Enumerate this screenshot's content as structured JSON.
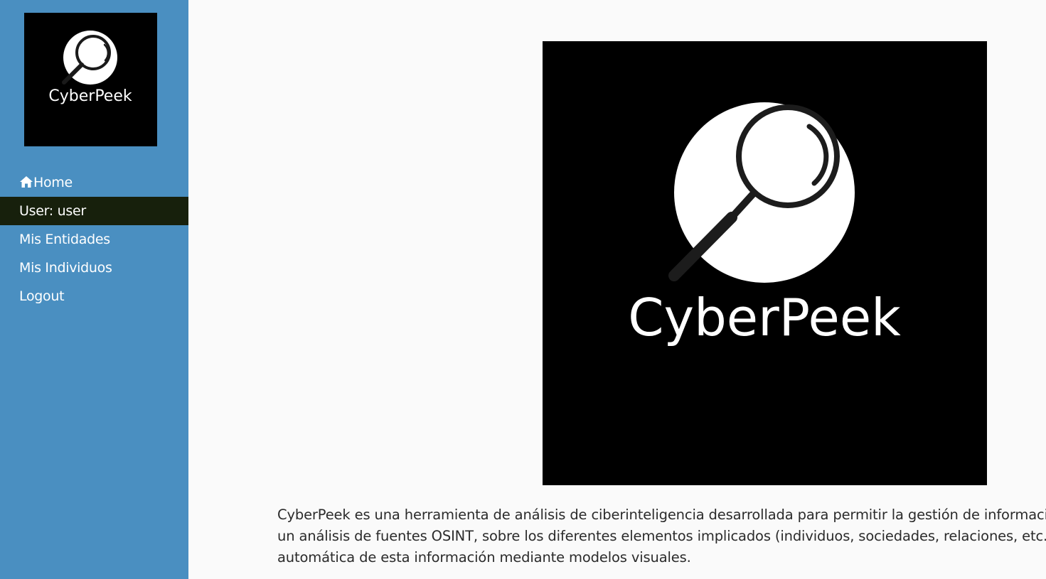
{
  "sidebar": {
    "logo": {
      "icon": "magnifier-icon",
      "text": "CyberPeek"
    },
    "nav": [
      {
        "icon": "home-icon",
        "label": "Home"
      },
      {
        "label": "User: user"
      },
      {
        "label": "Mis Entidades"
      },
      {
        "label": "Mis Individuos"
      },
      {
        "label": "Logout"
      }
    ]
  },
  "main": {
    "hero": {
      "icon": "magnifier-icon",
      "text": "CyberPeek"
    },
    "description": {
      "lines": [
        "CyberPeek es una herramienta de análisis de ciberinteligencia desarrollada para permitir la gestión de información",
        "un análisis de fuentes OSINT, sobre los diferentes elementos implicados (individuos, sociedades, relaciones, etc.)",
        "automática de esta información mediante modelos visuales."
      ]
    }
  },
  "colors": {
    "sidebar_bg": "#4a8fc1",
    "active_item_bg": "#17200c",
    "page_bg": "#fafafa",
    "logo_bg": "#000000"
  }
}
